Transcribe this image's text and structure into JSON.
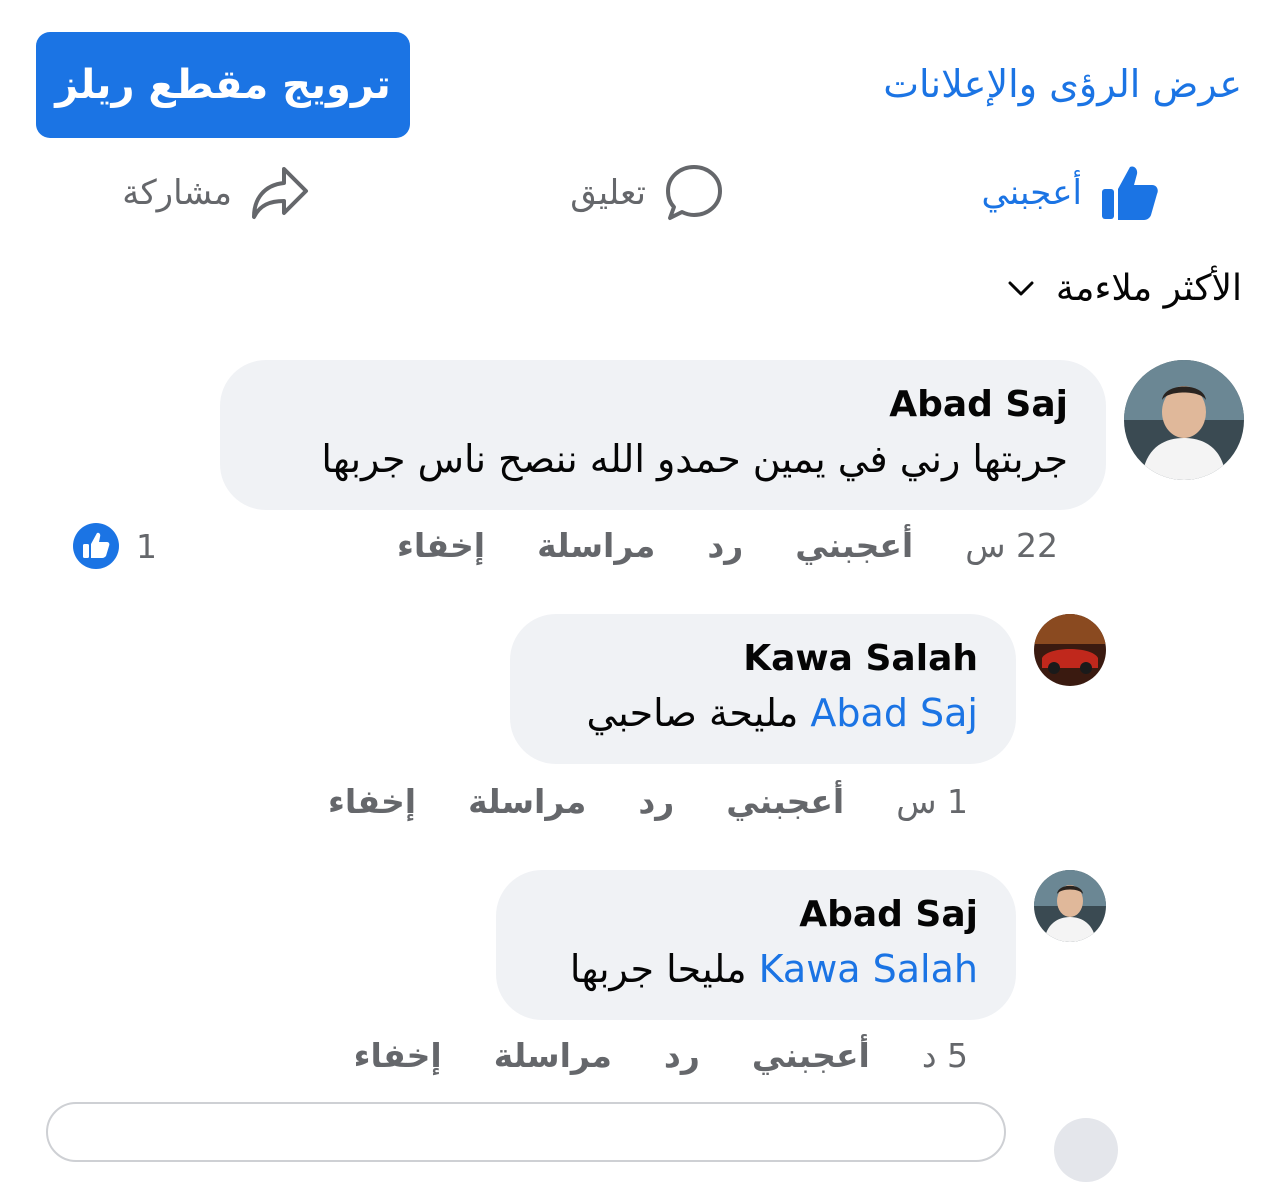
{
  "header": {
    "promote_label": "ترويج مقطع ريلز",
    "insights_label": "عرض الرؤى والإعلانات"
  },
  "actions": {
    "like": "أعجبني",
    "comment": "تعليق",
    "share": "مشاركة"
  },
  "sort_label": "الأكثر ملاءمة",
  "comments": [
    {
      "author": "Abad Saj",
      "mention": "",
      "text": "جربتها رني في يمين حمدو الله ننصح ناس جربها",
      "time": "22 س",
      "like": "أعجبني",
      "reply": "رد",
      "message": "مراسلة",
      "hide": "إخفاء",
      "reaction_count": "1"
    },
    {
      "author": "Kawa Salah",
      "mention": "Abad Saj",
      "text": "مليحة صاحبي",
      "time": "1 س",
      "like": "أعجبني",
      "reply": "رد",
      "message": "مراسلة",
      "hide": "إخفاء"
    },
    {
      "author": "Abad Saj",
      "mention": "Kawa Salah",
      "text": "مليحا جربها",
      "time": "5 د",
      "like": "أعجبني",
      "reply": "رد",
      "message": "مراسلة",
      "hide": "إخفاء"
    }
  ],
  "colors": {
    "accent": "#1b74e4",
    "bubble": "#f0f2f5",
    "muted": "#65676b"
  },
  "icons": {
    "like": "thumbs-up-icon",
    "comment": "speech-bubble-icon",
    "share": "share-arrow-icon",
    "sort": "chevron-down-icon",
    "reaction": "like-reaction-icon"
  }
}
